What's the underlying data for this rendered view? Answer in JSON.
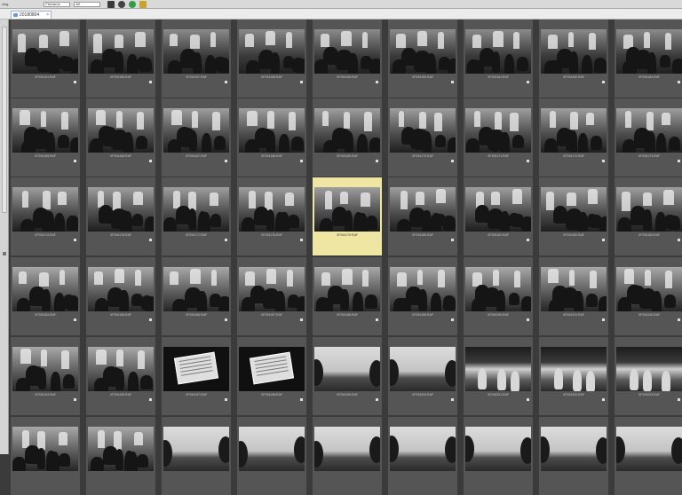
{
  "toolbar": {
    "left_label": "ving",
    "dropdown1": "Filename",
    "dropdown2": "All",
    "icons": [
      "printer-icon",
      "rotate-icon",
      "refresh-icon",
      "tag-icon"
    ],
    "icon_colors": [
      "#3a3a3a",
      "#444444",
      "#2f9e44",
      "#c9a227"
    ]
  },
  "tab": {
    "label": "20180804"
  },
  "grid": {
    "rows": [
      {
        "scene": "sceneA",
        "files": [
          "XF294151.RAF",
          "XF294155.RAF",
          "XF294157.RAF",
          "XF294158.RAF",
          "XF294159.RAF",
          "XF294160.RAF",
          "XF294161.RAF",
          "XF294162.RAF",
          "XF294163.RAF"
        ]
      },
      {
        "scene": "sceneB",
        "files": [
          "XF294165.RAF",
          "XF294166.RAF",
          "XF294167.RAF",
          "XF294168.RAF",
          "XF294169.RAF",
          "XF294170.RAF",
          "XF294171.RAF",
          "XF294172.RAF",
          "XF294173.RAF"
        ]
      },
      {
        "scene": "sceneB",
        "files": [
          "XF294174.RAF",
          "XF294176.RAF",
          "XF294177.RAF",
          "XF294178.RAF",
          "XF294179.RAF",
          "XF294180.RAF",
          "XF294181.RAF",
          "XF294182.RAF",
          "XF294183.RAF"
        ]
      },
      {
        "scene": "sceneC",
        "files": [
          "XF294184.RAF",
          "XF294185.RAF",
          "XF294186.RAF",
          "XF294187.RAF",
          "XF294188.RAF",
          "XF294189.RAF",
          "XF294190.RAF",
          "XF294191.RAF",
          "XF294192.RAF"
        ]
      },
      {
        "scene": "mixed",
        "files": [
          "XF294194.RAF",
          "XF294195.RAF",
          "XF294197.RAF",
          "XF294198.RAF",
          "XF294199.RAF",
          "XF294200.RAF",
          "XF294201.RAF",
          "XF294202.RAF",
          "XF294203.RAF"
        ]
      },
      {
        "scene": "land",
        "files": [
          "",
          "",
          "",
          "",
          "",
          "",
          "",
          "",
          ""
        ]
      }
    ],
    "row4_scenes": [
      "sceneC",
      "sceneC",
      "sign",
      "sign",
      "land",
      "land",
      "garden",
      "garden",
      "garden"
    ],
    "selected": {
      "row": 2,
      "col": 4
    }
  }
}
